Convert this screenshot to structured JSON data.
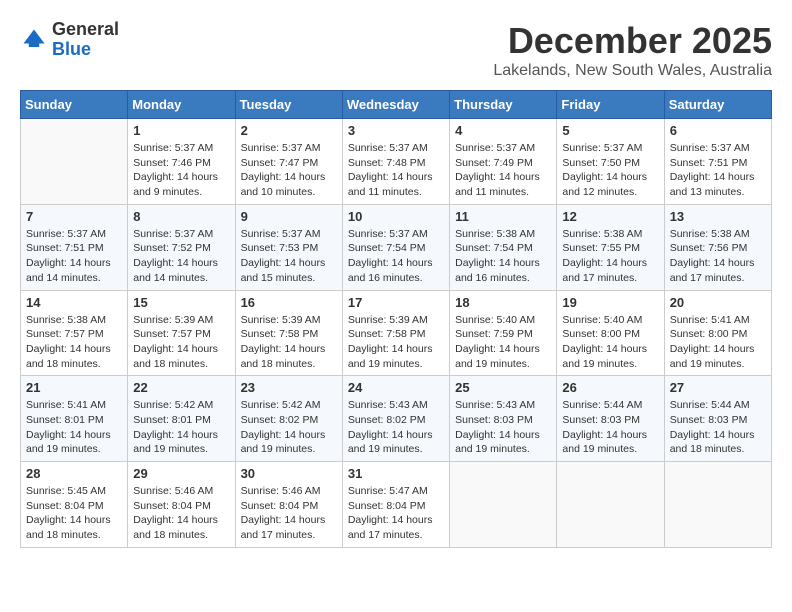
{
  "header": {
    "logo_general": "General",
    "logo_blue": "Blue",
    "month_title": "December 2025",
    "location": "Lakelands, New South Wales, Australia"
  },
  "calendar": {
    "days_of_week": [
      "Sunday",
      "Monday",
      "Tuesday",
      "Wednesday",
      "Thursday",
      "Friday",
      "Saturday"
    ],
    "weeks": [
      [
        {
          "day": "",
          "info": ""
        },
        {
          "day": "1",
          "info": "Sunrise: 5:37 AM\nSunset: 7:46 PM\nDaylight: 14 hours\nand 9 minutes."
        },
        {
          "day": "2",
          "info": "Sunrise: 5:37 AM\nSunset: 7:47 PM\nDaylight: 14 hours\nand 10 minutes."
        },
        {
          "day": "3",
          "info": "Sunrise: 5:37 AM\nSunset: 7:48 PM\nDaylight: 14 hours\nand 11 minutes."
        },
        {
          "day": "4",
          "info": "Sunrise: 5:37 AM\nSunset: 7:49 PM\nDaylight: 14 hours\nand 11 minutes."
        },
        {
          "day": "5",
          "info": "Sunrise: 5:37 AM\nSunset: 7:50 PM\nDaylight: 14 hours\nand 12 minutes."
        },
        {
          "day": "6",
          "info": "Sunrise: 5:37 AM\nSunset: 7:51 PM\nDaylight: 14 hours\nand 13 minutes."
        }
      ],
      [
        {
          "day": "7",
          "info": "Sunrise: 5:37 AM\nSunset: 7:51 PM\nDaylight: 14 hours\nand 14 minutes."
        },
        {
          "day": "8",
          "info": "Sunrise: 5:37 AM\nSunset: 7:52 PM\nDaylight: 14 hours\nand 14 minutes."
        },
        {
          "day": "9",
          "info": "Sunrise: 5:37 AM\nSunset: 7:53 PM\nDaylight: 14 hours\nand 15 minutes."
        },
        {
          "day": "10",
          "info": "Sunrise: 5:37 AM\nSunset: 7:54 PM\nDaylight: 14 hours\nand 16 minutes."
        },
        {
          "day": "11",
          "info": "Sunrise: 5:38 AM\nSunset: 7:54 PM\nDaylight: 14 hours\nand 16 minutes."
        },
        {
          "day": "12",
          "info": "Sunrise: 5:38 AM\nSunset: 7:55 PM\nDaylight: 14 hours\nand 17 minutes."
        },
        {
          "day": "13",
          "info": "Sunrise: 5:38 AM\nSunset: 7:56 PM\nDaylight: 14 hours\nand 17 minutes."
        }
      ],
      [
        {
          "day": "14",
          "info": "Sunrise: 5:38 AM\nSunset: 7:57 PM\nDaylight: 14 hours\nand 18 minutes."
        },
        {
          "day": "15",
          "info": "Sunrise: 5:39 AM\nSunset: 7:57 PM\nDaylight: 14 hours\nand 18 minutes."
        },
        {
          "day": "16",
          "info": "Sunrise: 5:39 AM\nSunset: 7:58 PM\nDaylight: 14 hours\nand 18 minutes."
        },
        {
          "day": "17",
          "info": "Sunrise: 5:39 AM\nSunset: 7:58 PM\nDaylight: 14 hours\nand 19 minutes."
        },
        {
          "day": "18",
          "info": "Sunrise: 5:40 AM\nSunset: 7:59 PM\nDaylight: 14 hours\nand 19 minutes."
        },
        {
          "day": "19",
          "info": "Sunrise: 5:40 AM\nSunset: 8:00 PM\nDaylight: 14 hours\nand 19 minutes."
        },
        {
          "day": "20",
          "info": "Sunrise: 5:41 AM\nSunset: 8:00 PM\nDaylight: 14 hours\nand 19 minutes."
        }
      ],
      [
        {
          "day": "21",
          "info": "Sunrise: 5:41 AM\nSunset: 8:01 PM\nDaylight: 14 hours\nand 19 minutes."
        },
        {
          "day": "22",
          "info": "Sunrise: 5:42 AM\nSunset: 8:01 PM\nDaylight: 14 hours\nand 19 minutes."
        },
        {
          "day": "23",
          "info": "Sunrise: 5:42 AM\nSunset: 8:02 PM\nDaylight: 14 hours\nand 19 minutes."
        },
        {
          "day": "24",
          "info": "Sunrise: 5:43 AM\nSunset: 8:02 PM\nDaylight: 14 hours\nand 19 minutes."
        },
        {
          "day": "25",
          "info": "Sunrise: 5:43 AM\nSunset: 8:03 PM\nDaylight: 14 hours\nand 19 minutes."
        },
        {
          "day": "26",
          "info": "Sunrise: 5:44 AM\nSunset: 8:03 PM\nDaylight: 14 hours\nand 19 minutes."
        },
        {
          "day": "27",
          "info": "Sunrise: 5:44 AM\nSunset: 8:03 PM\nDaylight: 14 hours\nand 18 minutes."
        }
      ],
      [
        {
          "day": "28",
          "info": "Sunrise: 5:45 AM\nSunset: 8:04 PM\nDaylight: 14 hours\nand 18 minutes."
        },
        {
          "day": "29",
          "info": "Sunrise: 5:46 AM\nSunset: 8:04 PM\nDaylight: 14 hours\nand 18 minutes."
        },
        {
          "day": "30",
          "info": "Sunrise: 5:46 AM\nSunset: 8:04 PM\nDaylight: 14 hours\nand 17 minutes."
        },
        {
          "day": "31",
          "info": "Sunrise: 5:47 AM\nSunset: 8:04 PM\nDaylight: 14 hours\nand 17 minutes."
        },
        {
          "day": "",
          "info": ""
        },
        {
          "day": "",
          "info": ""
        },
        {
          "day": "",
          "info": ""
        }
      ]
    ]
  }
}
